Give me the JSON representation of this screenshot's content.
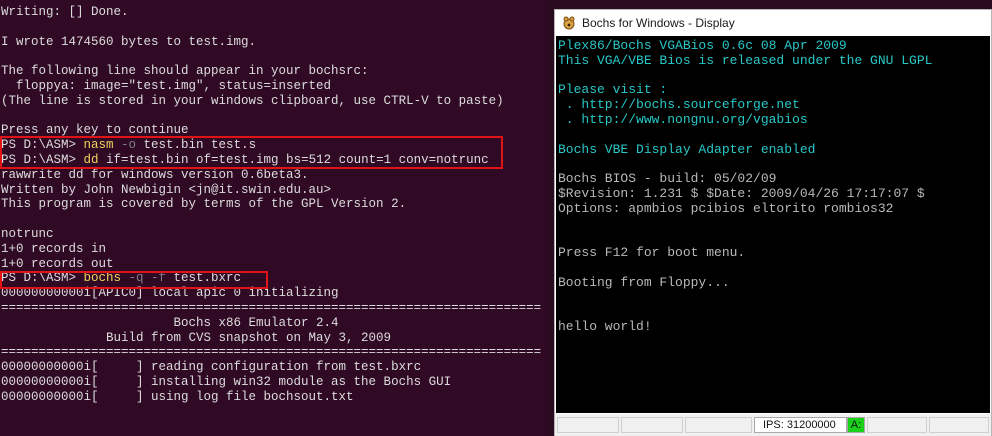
{
  "terminal": {
    "lines": [
      "Writing: [] Done.",
      "",
      "I wrote 1474560 bytes to test.img.",
      "",
      "The following line should appear in your bochsrc:",
      "  floppya: image=\"test.img\", status=inserted",
      "(The line is stored in your windows clipboard, use CTRL-V to paste)",
      "",
      "Press any key to continue",
      "PS D:\\ASM> nasm -o test.bin test.s",
      "PS D:\\ASM> dd if=test.bin of=test.img bs=512 count=1 conv=notrunc",
      "rawwrite dd for windows version 0.6beta3.",
      "Written by John Newbigin <jn@it.swin.edu.au>",
      "This program is covered by terms of the GPL Version 2.",
      "",
      "notrunc",
      "1+0 records in",
      "1+0 records out",
      "PS D:\\ASM> bochs -q -f test.bxrc",
      "00000000000i[APIC0] local apic 0 initializing",
      "========================================================================",
      "                       Bochs x86 Emulator 2.4",
      "              Build from CVS snapshot on May 3, 2009",
      "========================================================================",
      "00000000000i[     ] reading configuration from test.bxrc",
      "00000000000i[     ] installing win32 module as the Bochs GUI",
      "00000000000i[     ] using log file bochsout.txt"
    ],
    "cmd_nasm": {
      "prompt": "PS D:\\ASM> ",
      "command": "nasm",
      "arg": " -o",
      "rest": " test.bin test.s"
    },
    "cmd_dd": {
      "prompt": "PS D:\\ASM> ",
      "command": "dd",
      "rest": " if=test.bin of=test.img bs=512 count=1 conv=notrunc"
    },
    "cmd_bochs": {
      "prompt": "PS D:\\ASM> ",
      "command": "bochs",
      "arg": " -q -f",
      "rest": " test.bxrc"
    }
  },
  "bochs_window": {
    "title": "Bochs for Windows - Display",
    "screen_lines": [
      {
        "text": "Plex86/Bochs VGABios 0.6c 08 Apr 2009",
        "color": "cyan"
      },
      {
        "text": "This VGA/VBE Bios is released under the GNU LGPL",
        "color": "cyan"
      },
      {
        "text": "",
        "color": "cyan"
      },
      {
        "text": "Please visit :",
        "color": "cyan"
      },
      {
        "text": " . http://bochs.sourceforge.net",
        "color": "cyan"
      },
      {
        "text": " . http://www.nongnu.org/vgabios",
        "color": "cyan"
      },
      {
        "text": "",
        "color": "cyan"
      },
      {
        "text": "Bochs VBE Display Adapter enabled",
        "color": "cyan"
      },
      {
        "text": "",
        "color": "grey"
      },
      {
        "text": "Bochs BIOS - build: 05/02/09",
        "color": "grey"
      },
      {
        "text": "$Revision: 1.231 $ $Date: 2009/04/26 17:17:07 $",
        "color": "grey"
      },
      {
        "text": "Options: apmbios pcibios eltorito rombios32",
        "color": "grey"
      },
      {
        "text": "",
        "color": "grey"
      },
      {
        "text": "",
        "color": "grey"
      },
      {
        "text": "Press F12 for boot menu.",
        "color": "grey"
      },
      {
        "text": "",
        "color": "grey"
      },
      {
        "text": "Booting from Floppy...",
        "color": "grey"
      },
      {
        "text": "",
        "color": "grey"
      },
      {
        "text": "",
        "color": "grey"
      },
      {
        "text": "hello world!",
        "color": "grey"
      }
    ],
    "status": {
      "ips": "IPS: 31200000",
      "drive": "A:"
    }
  }
}
